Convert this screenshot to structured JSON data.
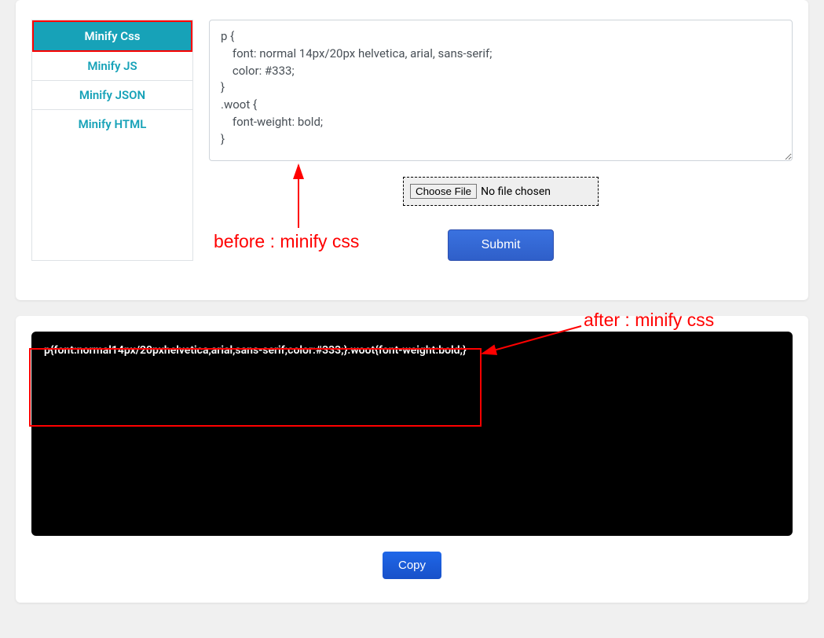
{
  "tabs": {
    "minify_css": "Minify Css",
    "minify_js": "Minify JS",
    "minify_json": "Minify JSON",
    "minify_html": "Minify HTML"
  },
  "input": {
    "css_value": "p {\n    font: normal 14px/20px helvetica, arial, sans-serif;\n    color: #333;\n}\n.woot {\n    font-weight: bold;\n}"
  },
  "file_picker": {
    "button": "Choose File",
    "status": "No file chosen"
  },
  "buttons": {
    "submit": "Submit",
    "copy": "Copy"
  },
  "output": {
    "minified": "p{font:normal14px/20pxhelvetica,arial,sans-serif;color:#333;}.woot{font-weight:bold;}"
  },
  "annotations": {
    "before": "before : minify css",
    "after": "after : minify css"
  }
}
